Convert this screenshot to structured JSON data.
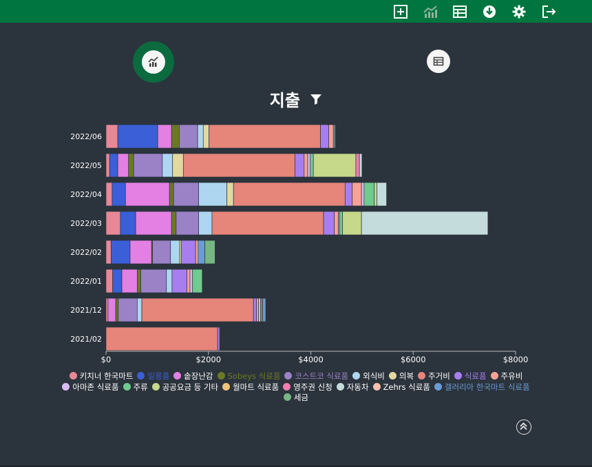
{
  "toolbar": {
    "icons": [
      "add-square-icon",
      "chart-trend-icon",
      "table-icon",
      "download-icon",
      "settings-gear-icon",
      "logout-icon"
    ],
    "color": "#00753f"
  },
  "view_toggle": {
    "chart_icon": "chart-icon",
    "table_icon": "table-icon",
    "selected": "chart"
  },
  "title": "지출",
  "filter_icon": "filter-icon",
  "scroll_top_icon": "double-chevron-up-icon",
  "chart_data": {
    "type": "bar",
    "orientation": "horizontal",
    "stacked": true,
    "categories": [
      "2022/06",
      "2022/05",
      "2022/04",
      "2022/03",
      "2022/02",
      "2022/01",
      "2021/12",
      "2021/02"
    ],
    "x_ticks": [
      "$0",
      "$2000",
      "$4000",
      "$6000",
      "$8000"
    ],
    "xlim": [
      0,
      8000
    ],
    "legend_position": "bottom",
    "series": [
      {
        "name": "키치너 한국마트",
        "color": "#e88896",
        "values": [
          230,
          70,
          120,
          280,
          100,
          130,
          40,
          0
        ]
      },
      {
        "name": "일용품",
        "color": "#3a5fd6",
        "values": [
          780,
          160,
          260,
          300,
          370,
          180,
          0,
          0
        ]
      },
      {
        "name": "솥장난감",
        "color": "#e47fe3",
        "values": [
          270,
          210,
          860,
          700,
          420,
          300,
          150,
          0
        ]
      },
      {
        "name": "Sobeys 식료품",
        "color": "#6b7a22",
        "values": [
          150,
          100,
          80,
          90,
          20,
          70,
          50,
          0
        ]
      },
      {
        "name": "코스트코 식료품",
        "color": "#9b82c7",
        "values": [
          360,
          560,
          490,
          440,
          350,
          500,
          370,
          0
        ]
      },
      {
        "name": "외식비",
        "color": "#aed6f1",
        "values": [
          110,
          200,
          550,
          260,
          180,
          110,
          90,
          0
        ]
      },
      {
        "name": "의복",
        "color": "#e2d8a0",
        "values": [
          110,
          210,
          130,
          0,
          30,
          0,
          0,
          0
        ]
      },
      {
        "name": "주거비",
        "color": "#e6857a",
        "values": [
          2180,
          2180,
          2180,
          2180,
          0,
          0,
          2180,
          2180
        ]
      },
      {
        "name": "식료품",
        "color": "#a77ef0",
        "values": [
          160,
          180,
          140,
          210,
          280,
          290,
          60,
          40
        ]
      },
      {
        "name": "주유비",
        "color": "#f7a296",
        "values": [
          90,
          70,
          180,
          80,
          50,
          60,
          40,
          0
        ]
      },
      {
        "name": "아마존 식료품",
        "color": "#d9baf3",
        "values": [
          20,
          50,
          50,
          20,
          0,
          50,
          40,
          0
        ]
      },
      {
        "name": "주류",
        "color": "#6fcb8e",
        "values": [
          20,
          60,
          200,
          60,
          0,
          190,
          20,
          0
        ]
      },
      {
        "name": "공공요금 등 기타",
        "color": "#c6d88a",
        "values": [
          0,
          830,
          50,
          370,
          0,
          0,
          0,
          0
        ]
      },
      {
        "name": "월마트 식료품",
        "color": "#edc478",
        "values": [
          0,
          0,
          0,
          0,
          0,
          0,
          20,
          0
        ]
      },
      {
        "name": "영주권 신청",
        "color": "#f07eb0",
        "values": [
          0,
          70,
          0,
          0,
          0,
          0,
          0,
          0
        ]
      },
      {
        "name": "자동차",
        "color": "#c4dcdc",
        "values": [
          0,
          50,
          190,
          2470,
          0,
          0,
          0,
          0
        ]
      },
      {
        "name": "Zehrs 식료품",
        "color": "#f5bfae",
        "values": [
          0,
          0,
          0,
          0,
          0,
          0,
          0,
          0
        ]
      },
      {
        "name": "갤러리아 한국마트 식료품",
        "color": "#6b9cd6",
        "values": [
          0,
          0,
          0,
          0,
          130,
          0,
          60,
          0
        ]
      },
      {
        "name": "세금",
        "color": "#77b585",
        "values": [
          0,
          0,
          0,
          0,
          200,
          0,
          0,
          0
        ]
      }
    ]
  }
}
